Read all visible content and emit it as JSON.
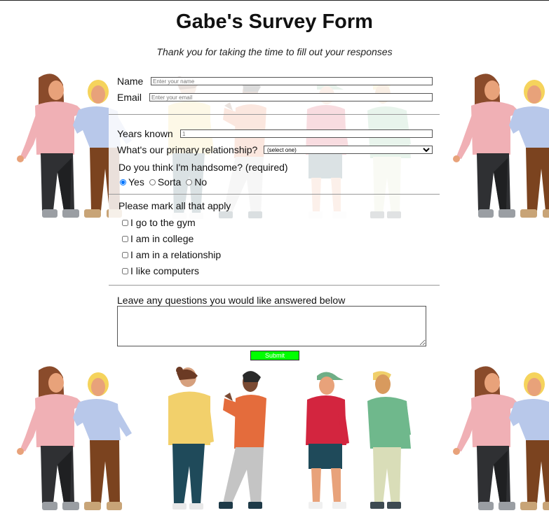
{
  "header": {
    "title": "Gabe's Survey Form",
    "subtitle": "Thank you for taking the time to fill out your responses"
  },
  "form": {
    "name_label": "Name",
    "name_placeholder": "Enter your name",
    "email_label": "Email",
    "email_placeholder": "Enter your email",
    "years_label": "Years known",
    "years_placeholder": "1",
    "relationship_label": "What's our primary relationship?",
    "relationship_selected": "(select one)",
    "handsome_label": "Do you think I'm handsome? (required)",
    "radios": [
      {
        "label": "Yes",
        "checked": true
      },
      {
        "label": "Sorta",
        "checked": false
      },
      {
        "label": "No",
        "checked": false
      }
    ],
    "checks_label": "Please mark all that apply",
    "checks": [
      "I go to the gym",
      "I am in college",
      "I am in a relationship",
      "I like computers"
    ],
    "questions_label": "Leave any questions you would like answered below",
    "submit_label": "Submit"
  },
  "colors": {
    "submit_bg": "#00ff00",
    "divider": "#999999"
  }
}
